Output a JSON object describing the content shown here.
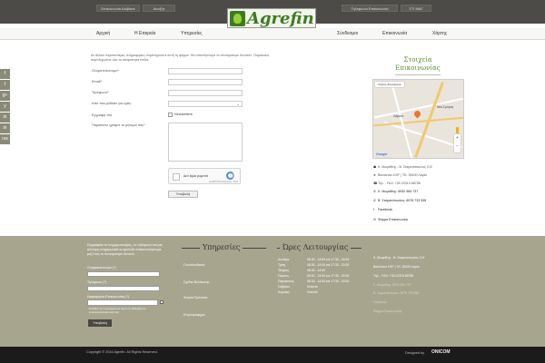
{
  "topbar": {
    "left_buttons": [
      "Επικοινωνία Διάβασε",
      "Αναζήτ"
    ],
    "right_buttons": [
      "Τηλεφωνα Επικοινωνία",
      "ΣΤΙ ΜΑΓ"
    ]
  },
  "logo": {
    "text": "Agrefin"
  },
  "nav": {
    "items": [
      "Αρχική",
      "Η Εταιρεία",
      "Υπηρεσίες",
      "Σύνδεσμοι",
      "Επικοινωνία",
      "Χάρτης"
    ]
  },
  "social": {
    "items": [
      "f",
      "t",
      "g+",
      "y",
      "in",
      "in",
      "rss"
    ]
  },
  "form": {
    "intro": "Αν θέλετε περισσότερες πληροφορίες συμπληρώστε αυτή τη φόρμα. Θα απαντήσουμε το συντομότερο δυνατόν. Παρακαλώ συμπληρώστε όλα τα απαραίτητα πεδία.",
    "labels": [
      "Ονοματεπώνυμο*",
      "Email*",
      "Τηλέφωνο*",
      "Από που μάθατε για εμάς:",
      "Εγγραφή στο",
      "Παρακαλώ γράψτε το μήνυμά σας*"
    ],
    "newsletter_label": "Newsletters",
    "captcha": {
      "label": "Δεν είμαι ρομπότ",
      "privacy": "reCAPTCHA Απόρρητο - Όροι"
    },
    "send_label": "Υποβολή"
  },
  "sidebar": {
    "title": [
      "Στοιχεία",
      "Επικοινωνίας"
    ],
    "map": {
      "tab": "Χάρτης Δορυφόρος",
      "city": "Λάρισα",
      "city2": "Νέα Σμύρνη",
      "google": "Google"
    },
    "contacts": [
      {
        "icon": "☗",
        "text": "Κ. Μωραΐτης - Β. Σταματόπουλος Ο.Ε"
      },
      {
        "icon": "➤",
        "text": "Βασιλείου 109° | ΤΚ: 35100 Λαμία"
      },
      {
        "icon": "☎",
        "text": "Τηλ. - FAX: +30 22310 66756"
      },
      {
        "icon": "✆",
        "text": "Κ. Μωραΐτης: 6932 584 737",
        "bold": true
      },
      {
        "icon": "✆",
        "text": "Β. Σταματόπουλος: 6976 733 535",
        "bold": true
      },
      {
        "icon": "f",
        "text": "Facebook",
        "bold": true
      },
      {
        "icon": "✉",
        "text": "Φόρμα Επικοινωνίας",
        "bold": true
      }
    ]
  },
  "footer": {
    "newsletter_intro": "Εγγραφείτε το ενημερωτικόμας, το τηλέφωνο και μια σύντομη ενημερωτικά οι κρινή θα επικοινωνήσουμε μαζί σας το συντομότερο δυνατό.",
    "labels": [
      "Ονοματεπώνυμο (*)",
      "Τηλέφωνο (*)",
      "Ημερομηνία Επικοινωνίας (*)"
    ],
    "consent": "Επιλέξτε την προσφορά και αφού την δεδομένα σε επικοινωνήσουμε μαζί σας",
    "submit_label": "Υποβολή",
    "services_title": "Υπηρεσίες",
    "services": [
      "Γεωπόνοδιακά",
      "Σχέδια Βελτίωσης",
      "Φυτικά Πρότυπα",
      "Κτηνοτρόφημα"
    ],
    "hours_title": "Ώρες Λειτουργίας",
    "hours": [
      {
        "day": "Δευτέρα",
        "time": "08:30 - 14:00 και 17:30 - 20:30"
      },
      {
        "day": "Τρίτη",
        "time": "08:30 - 14:00 και 17:30 - 20:30"
      },
      {
        "day": "Τετάρτη",
        "time": "08:30 - 14:00"
      },
      {
        "day": "Πέμπτη",
        "time": "08:30 - 14:00 και 17:30 - 20:30"
      },
      {
        "day": "Παρασκευή",
        "time": "08:30 - 14:00 και 17:30 - 20:30"
      },
      {
        "day": "Σάββατο",
        "time": "Κλειστά"
      },
      {
        "day": "Κυριακή",
        "time": "Κλειστά"
      }
    ],
    "contacts": [
      {
        "text": "Κ. Μωραΐτης - Β. Σταματόπουλος Ο.Ε",
        "dim": false
      },
      {
        "text": "Βασιλείου 109° | ΤΚ: 35100 Λαμία",
        "dim": false
      },
      {
        "text": "Τηλ. - FAX: +30 22310 66756",
        "dim": false
      },
      {
        "text": "Κ. Μωραΐτης: 6932 584 737",
        "dim": true
      },
      {
        "text": "Β. Σταματόπουλος: 6976 733 535",
        "dim": true
      },
      {
        "text": "Facebook",
        "dim": true
      },
      {
        "text": "Φόρμα Επικοινωνίας",
        "dim": true
      }
    ]
  },
  "bottom": {
    "copyright": "Copyright © 2016 Agrefin. All Rights Reserved.",
    "designed_by": "Designed by",
    "designer": "ONICOM"
  }
}
